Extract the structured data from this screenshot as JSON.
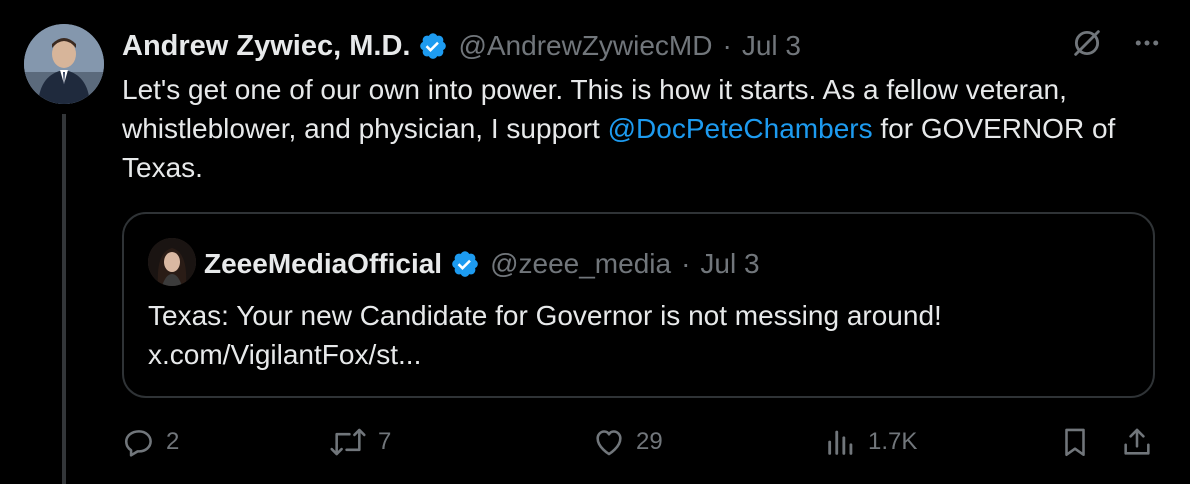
{
  "tweet": {
    "author_name": "Andrew Zywiec, M.D.",
    "handle": "@AndrewZywiecMD",
    "separator": "·",
    "date": "Jul 3",
    "text_parts": [
      "Let's get one of our own into power. This is how it starts. As a fellow veteran, whistleblower, and physician, I support ",
      "@DocPeteChambers",
      " for GOVERNOR of Texas."
    ]
  },
  "quote": {
    "author_name": "ZeeeMediaOfficial",
    "handle": "@zeee_media",
    "separator": "·",
    "date": "Jul 3",
    "text_line1": "Texas: Your new Candidate for Governor is not messing around!",
    "text_line2": "x.com/VigilantFox/st..."
  },
  "actions": {
    "replies": "2",
    "reposts": "7",
    "likes": "29",
    "views": "1.7K"
  },
  "colors": {
    "background": "#000000",
    "text": "#e7e9ea",
    "muted": "#71767b",
    "link": "#1d9bf0",
    "verified": "#1d9bf0",
    "border": "#2f3336"
  },
  "icons": [
    "verified-badge-icon",
    "grok-icon",
    "more-icon",
    "reply-icon",
    "repost-icon",
    "like-icon",
    "views-icon",
    "bookmark-icon",
    "share-icon"
  ]
}
